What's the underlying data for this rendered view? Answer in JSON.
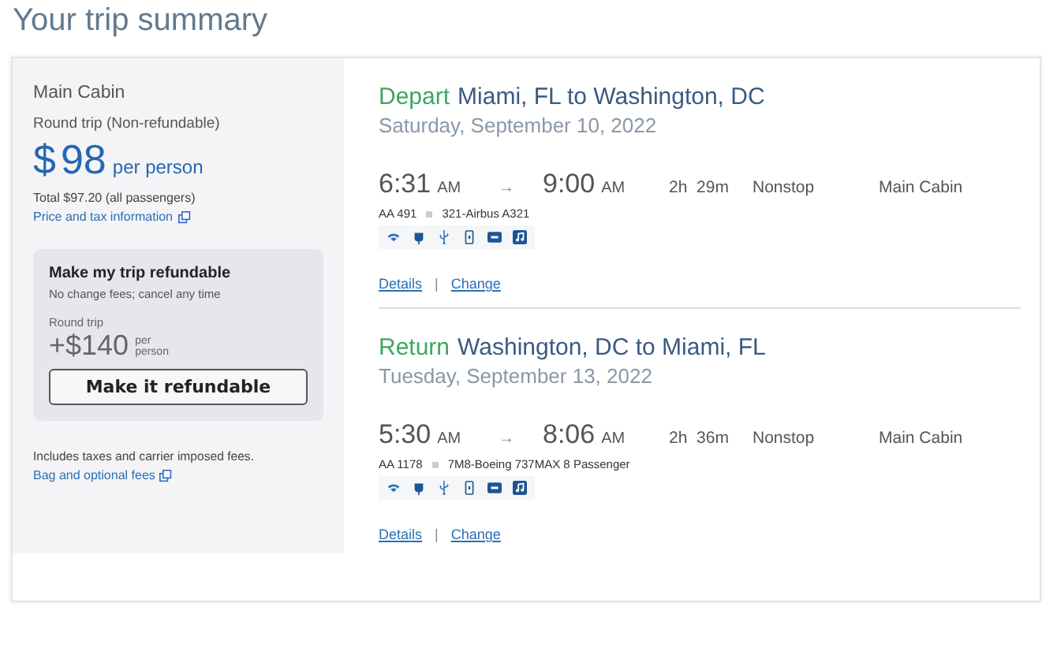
{
  "title": "Your trip summary",
  "fare": {
    "cabin": "Main Cabin",
    "trip_type": "Round trip (Non-refundable)",
    "currency": "$",
    "amount": "98",
    "per": "per person",
    "total": "Total $97.20 (all passengers)",
    "info_link": "Price and tax information"
  },
  "refund": {
    "title": "Make my trip refundable",
    "subtitle": "No change fees; cancel any time",
    "trip": "Round trip",
    "price": "+$140",
    "per_1": "per",
    "per_2": "person",
    "button": "Make it refundable"
  },
  "fees_note": "Includes taxes and carrier imposed fees.",
  "fees_link": "Bag and optional fees",
  "flights": [
    {
      "direction": "Depart",
      "route": "Miami, FL to Washington, DC",
      "date": "Saturday, September 10, 2022",
      "dep_time": "6:31",
      "dep_ampm": "AM",
      "arrow": "→",
      "arr_time": "9:00",
      "arr_ampm": "AM",
      "duration": "2h  29m",
      "stops": "Nonstop",
      "cabin": "Main Cabin",
      "flight_no": "AA 491",
      "aircraft": "321-Airbus A321",
      "details": "Details",
      "sep": "|",
      "change": "Change"
    },
    {
      "direction": "Return",
      "route": "Washington, DC to Miami, FL",
      "date": "Tuesday, September 13, 2022",
      "dep_time": "5:30",
      "dep_ampm": "AM",
      "arrow": "→",
      "arr_time": "8:06",
      "arr_ampm": "AM",
      "duration": "2h  36m",
      "stops": "Nonstop",
      "cabin": "Main Cabin",
      "flight_no": "AA 1178",
      "aircraft": "7M8-Boeing 737MAX 8 Passenger",
      "details": "Details",
      "sep": "|",
      "change": "Change"
    }
  ]
}
